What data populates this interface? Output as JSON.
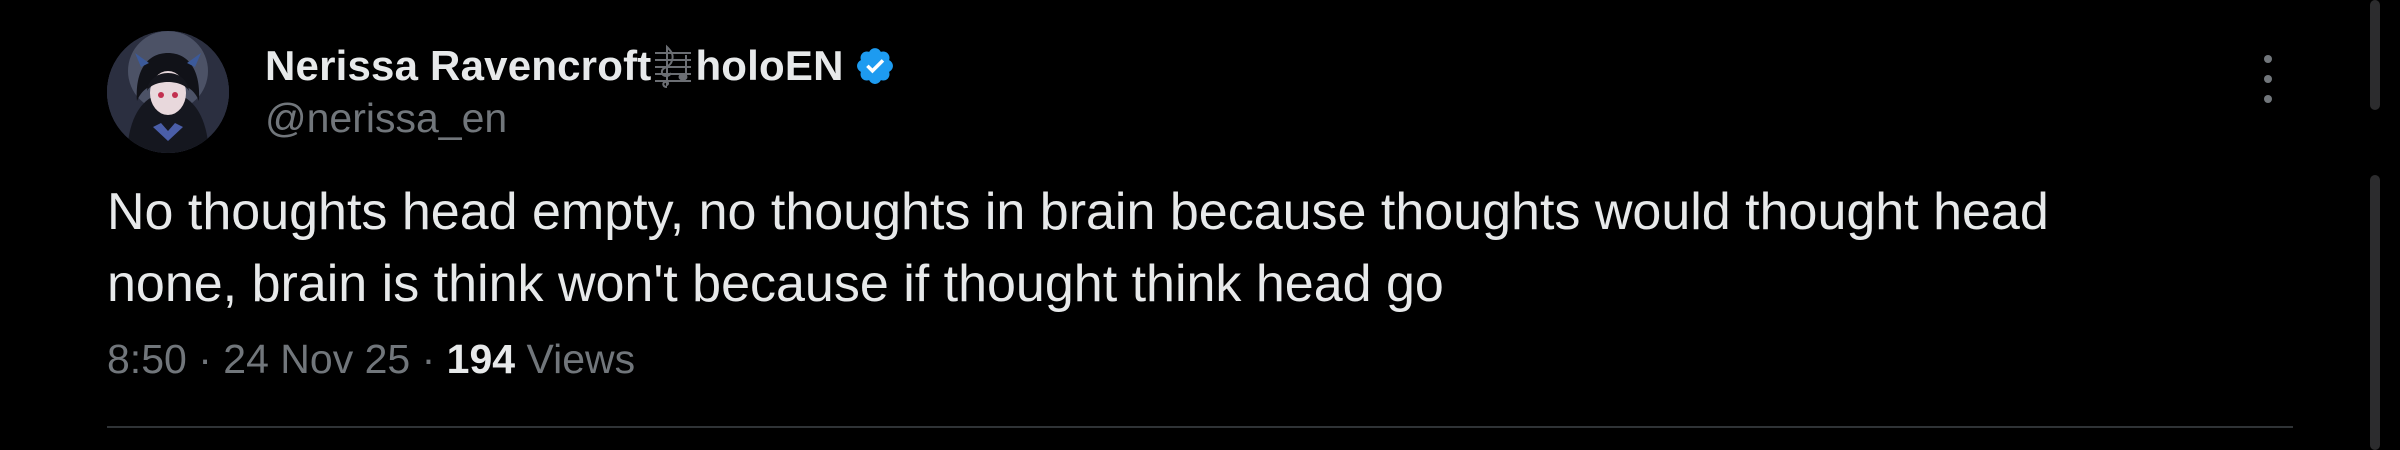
{
  "tweet": {
    "display_name_prefix": "Nerissa Ravencroft",
    "display_name_suffix": "holoEN",
    "handle": "@nerissa_en",
    "text_lines": [
      "No thoughts head empty, no thoughts in brain because thoughts would thought head",
      "none, brain is think won't because if thought think head go"
    ],
    "time": "8:50",
    "separator": "·",
    "date": "24 Nov 25",
    "views_count": "194",
    "views_label": "Views"
  },
  "icons": {
    "avatar": "profile-avatar",
    "music": "music-score-icon",
    "verified": "verified-badge-icon",
    "more": "more-options-icon"
  },
  "colors": {
    "background": "#000000",
    "primary_text": "#e7e9ea",
    "secondary_text": "#71767b",
    "verified_blue": "#1d9bf0",
    "divider": "#2f3336"
  }
}
